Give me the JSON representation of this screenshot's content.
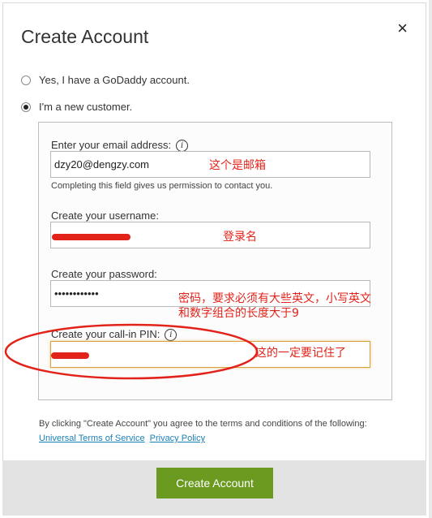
{
  "dialog": {
    "title": "Create Account",
    "close_icon": "×"
  },
  "account_type": {
    "options": [
      {
        "label": "Yes, I have a GoDaddy account.",
        "selected": false
      },
      {
        "label": "I'm a new customer.",
        "selected": true
      }
    ]
  },
  "form": {
    "email": {
      "label": "Enter your email address:",
      "value": "dzy20@dengzy.com",
      "hint": "Completing this field gives us permission to contact you."
    },
    "username": {
      "label": "Create your username:",
      "value": ""
    },
    "password": {
      "label": "Create your password:",
      "value": "••••••••••••"
    },
    "pin": {
      "label": "Create your call-in PIN:",
      "value": ""
    }
  },
  "annotations": {
    "email_note": "这个是邮箱",
    "username_note": "登录名",
    "password_note_line1": "密码，要求必须有大些英文，小写英文",
    "password_note_line2": "和数字组合的长度大于9",
    "pin_note": "这的一定要记住了"
  },
  "terms": {
    "text": "By clicking \"Create Account\" you agree to the terms and conditions of the following:",
    "link_tos": "Universal Terms of Service",
    "link_privacy": "Privacy Policy"
  },
  "footer": {
    "submit_label": "Create Account"
  },
  "colors": {
    "accent_green": "#6a9a1f",
    "annotation_red": "#e2231a",
    "link_blue": "#1a7fb5"
  }
}
